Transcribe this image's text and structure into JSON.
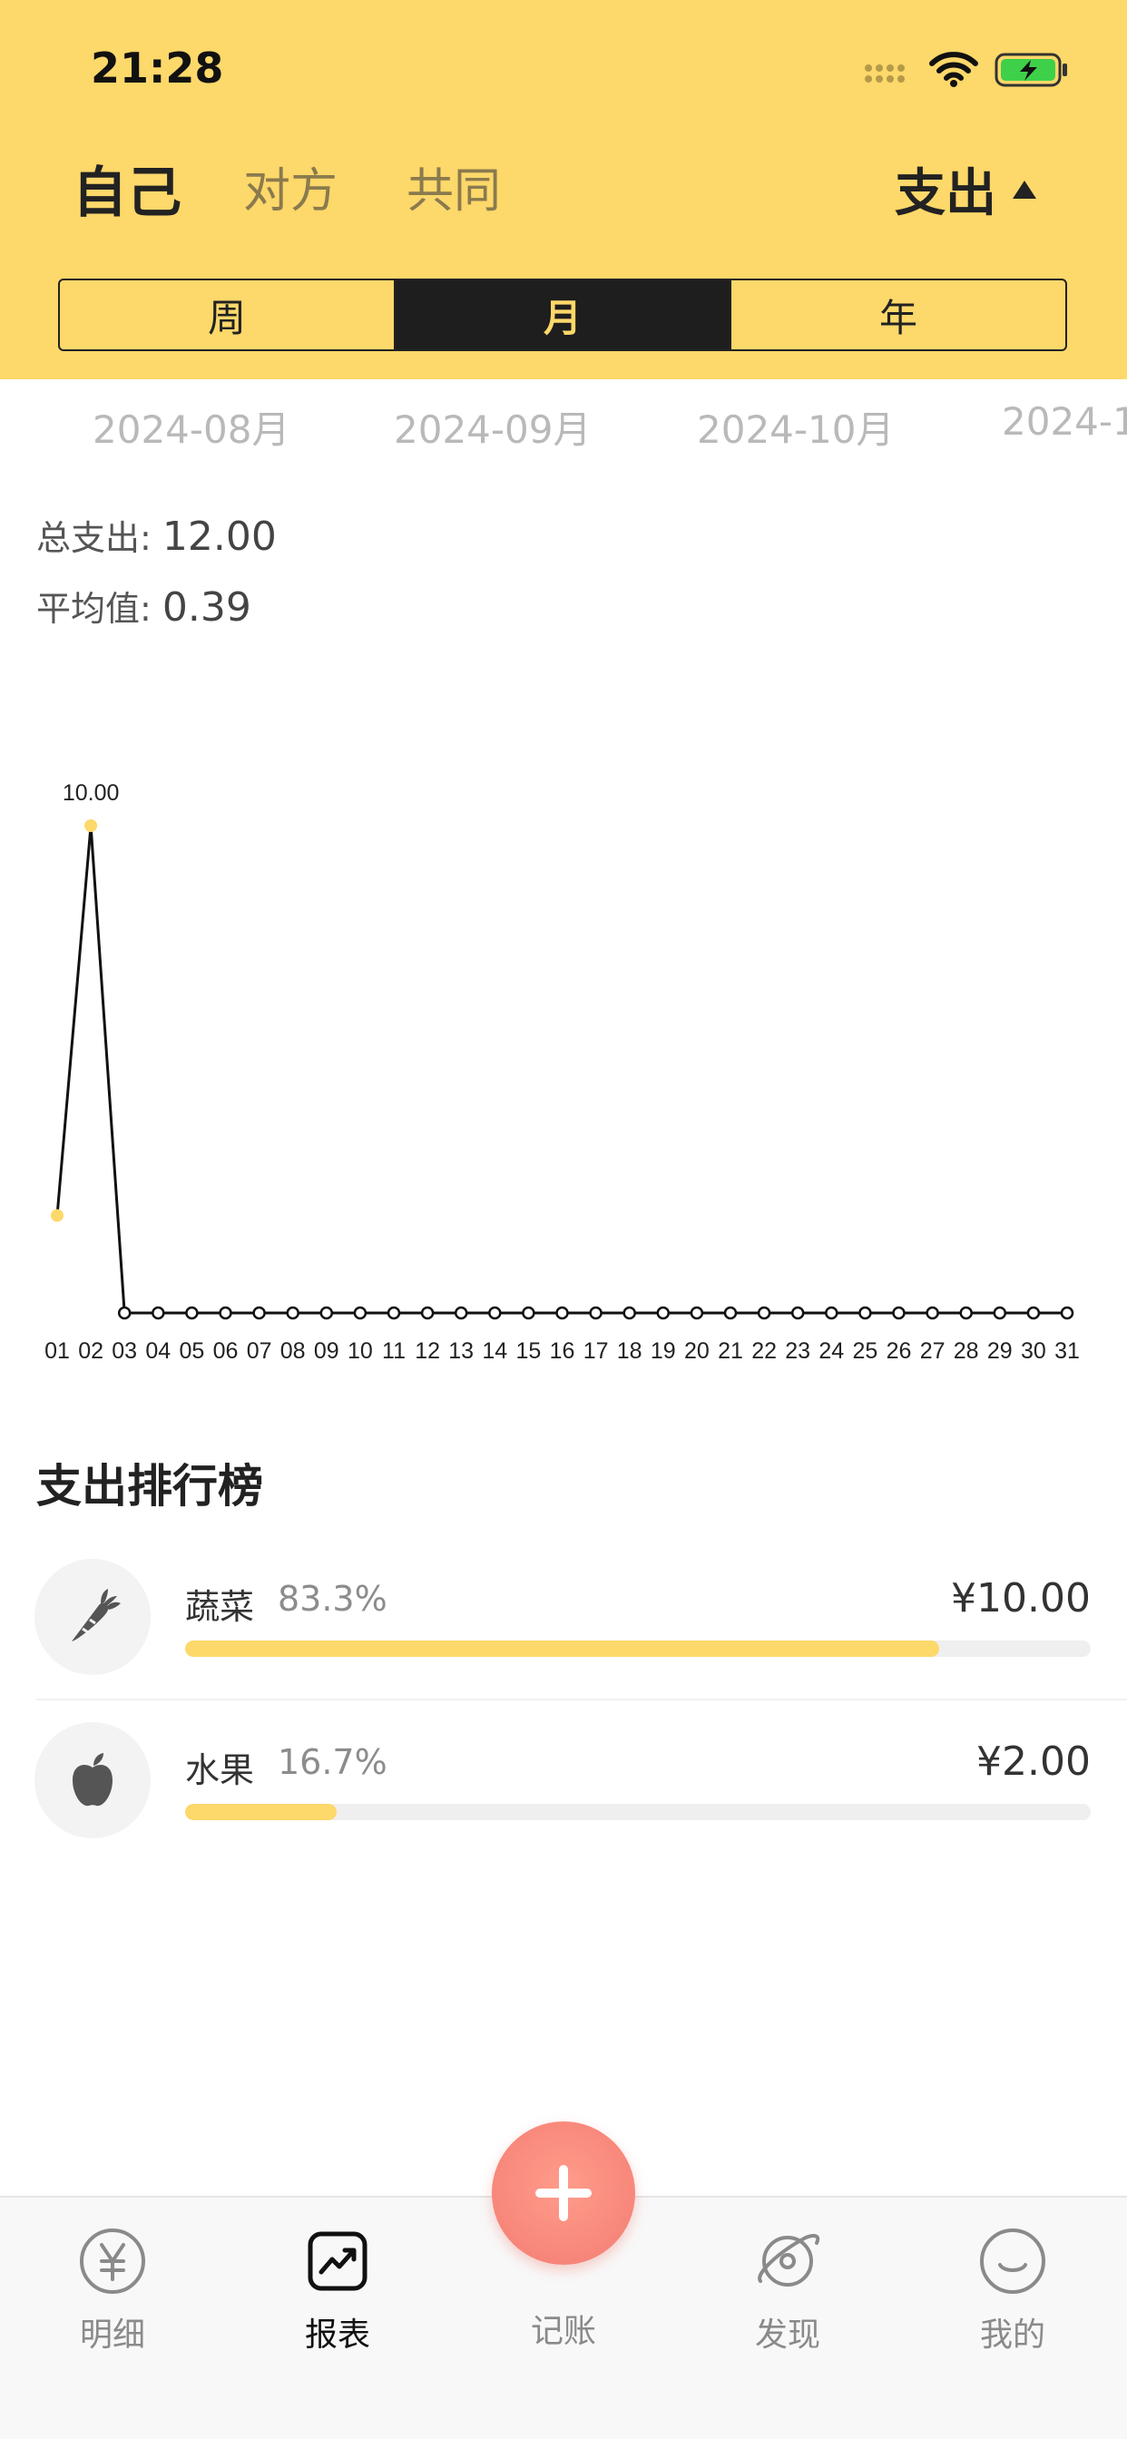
{
  "status_bar": {
    "time": "21:28"
  },
  "header": {
    "owner_tabs": [
      "自己",
      "对方",
      "共同"
    ],
    "active_owner": "自己",
    "type_toggle": "支出",
    "periods": [
      "周",
      "月",
      "年"
    ],
    "active_period": "月"
  },
  "months": [
    "2024-08月",
    "2024-09月",
    "2024-10月",
    "2024-1"
  ],
  "summary": {
    "total_label": "总支出:",
    "total_value": "12.00",
    "avg_label": "平均值:",
    "avg_value": "0.39"
  },
  "chart_data": {
    "type": "line",
    "title": "",
    "xlabel": "",
    "ylabel": "",
    "x": [
      "01",
      "02",
      "03",
      "04",
      "05",
      "06",
      "07",
      "08",
      "09",
      "10",
      "11",
      "12",
      "13",
      "14",
      "15",
      "16",
      "17",
      "18",
      "19",
      "20",
      "21",
      "22",
      "23",
      "24",
      "25",
      "26",
      "27",
      "28",
      "29",
      "30",
      "31"
    ],
    "values": [
      2.0,
      10.0,
      0,
      0,
      0,
      0,
      0,
      0,
      0,
      0,
      0,
      0,
      0,
      0,
      0,
      0,
      0,
      0,
      0,
      0,
      0,
      0,
      0,
      0,
      0,
      0,
      0,
      0,
      0,
      0,
      0
    ],
    "ylim": [
      0,
      10.0
    ],
    "annotations": [
      {
        "x": "02",
        "label": "10.00"
      }
    ],
    "grid": false,
    "colors": {
      "line": "#111111",
      "highlight": "#fdd86a"
    }
  },
  "ranking": {
    "title": "支出排行榜",
    "items": [
      {
        "name": "蔬菜",
        "percent": "83.3%",
        "amount": "¥10.00",
        "fraction": 0.833,
        "icon": "carrot-icon"
      },
      {
        "name": "水果",
        "percent": "16.7%",
        "amount": "¥2.00",
        "fraction": 0.167,
        "icon": "apple-icon"
      }
    ]
  },
  "tabbar": {
    "items": [
      "明细",
      "报表",
      "记账",
      "发现",
      "我的"
    ],
    "active": "报表"
  },
  "colors": {
    "accent": "#fdd86a",
    "fab": "#f7867a",
    "dark": "#1e1e1e"
  }
}
